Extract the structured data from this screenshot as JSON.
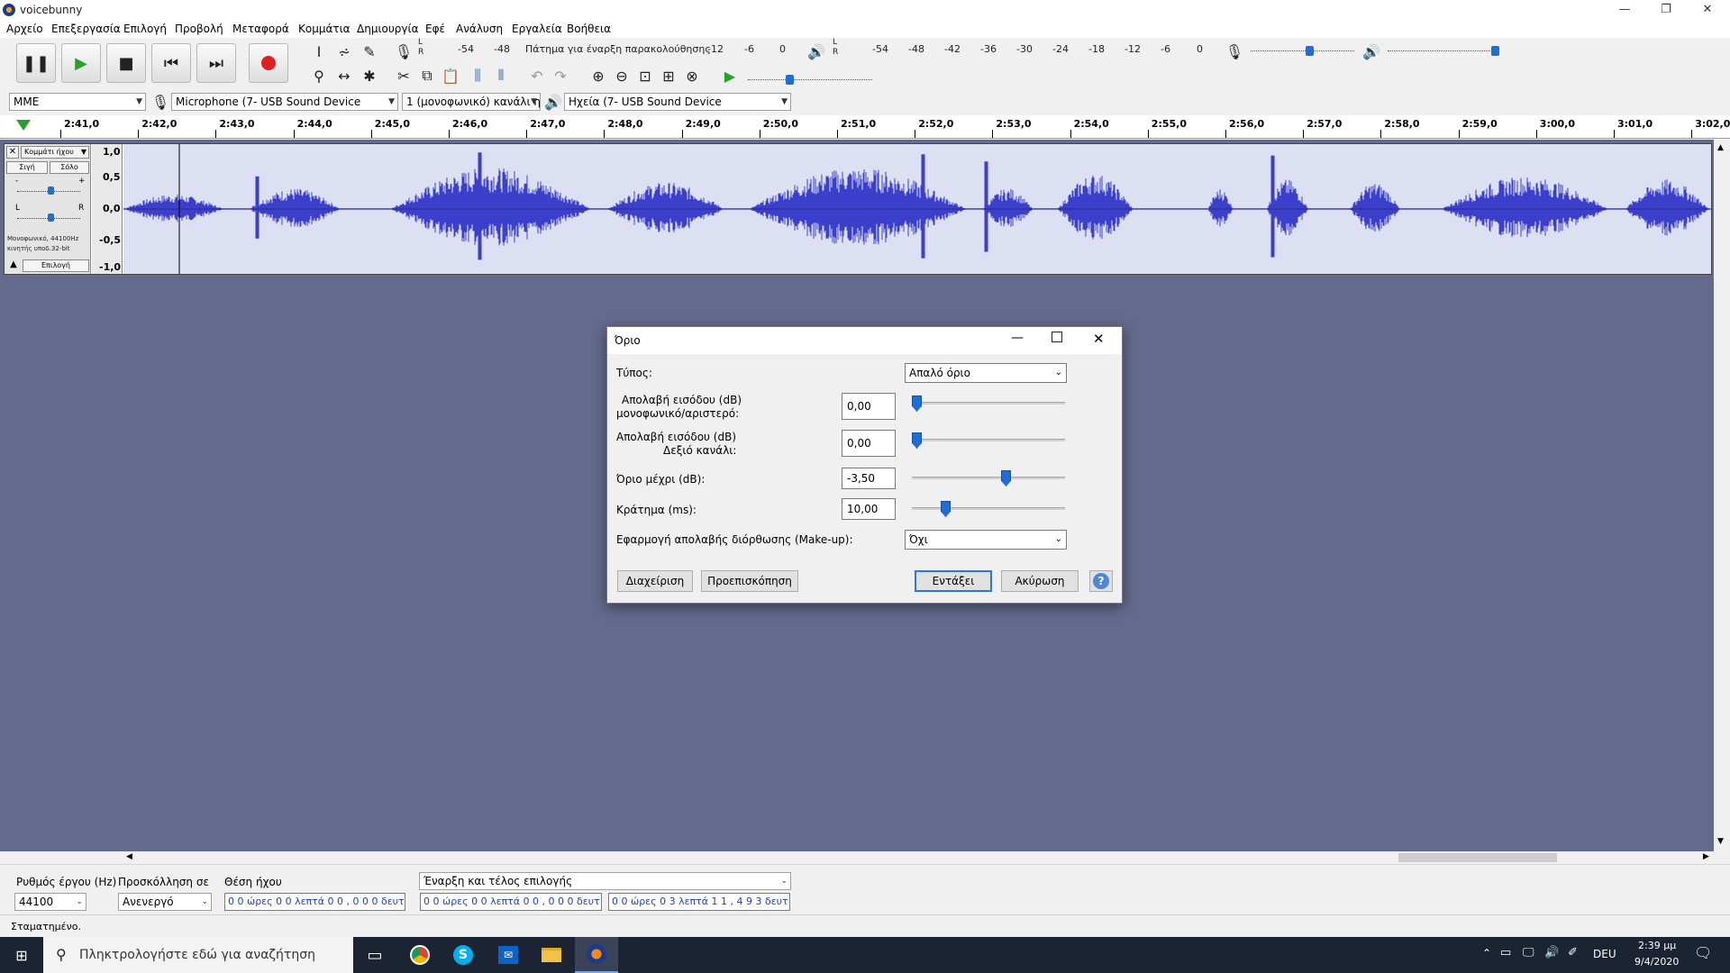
{
  "window": {
    "title": "voicebunny"
  },
  "menu": [
    "Αρχείο",
    "Επεξεργασία",
    "Επιλογή",
    "Προβολή",
    "Μεταφορά",
    "Κομμάτια",
    "Δημιουργία",
    "Εφέ",
    "Ανάλυση",
    "Εργαλεία",
    "Βοήθεια"
  ],
  "meters": {
    "rec_scale": [
      "-54",
      "-48",
      "Πάτημα για έναρξη παρακολούθησης",
      "-12",
      "-6",
      "0"
    ],
    "play_scale": [
      "-54",
      "-48",
      "-42",
      "-36",
      "-30",
      "-24",
      "-18",
      "-12",
      "-6",
      "0"
    ],
    "lr_l": "L",
    "lr_r": "R"
  },
  "devices": {
    "host": "MME",
    "recording": "Microphone (7- USB Sound Device",
    "channels": "1 (μονοφωνικό) κανάλι η",
    "playback": "Ηχεία (7- USB Sound Device"
  },
  "ruler": [
    "2:41,0",
    "2:42,0",
    "2:43,0",
    "2:44,0",
    "2:45,0",
    "2:46,0",
    "2:47,0",
    "2:48,0",
    "2:49,0",
    "2:50,0",
    "2:51,0",
    "2:52,0",
    "2:53,0",
    "2:54,0",
    "2:55,0",
    "2:56,0",
    "2:57,0",
    "2:58,0",
    "2:59,0",
    "3:00,0",
    "3:01,0",
    "3:02,0"
  ],
  "track": {
    "name": "Κομμάτι ήχου",
    "mute": "Σιγή",
    "solo": "Σόλο",
    "minus": "-",
    "plus": "+",
    "left": "L",
    "right": "R",
    "info": "Μονοφωνικό, 44100Hz κινητής υποδ.32-bit",
    "select": "Επιλογή",
    "scale": [
      "1,0",
      "0,5",
      "0,0",
      "-0,5",
      "-1,0"
    ]
  },
  "dialog": {
    "title": "Όριο",
    "type_label": "Τύπος:",
    "type_value": "Απαλό όριο",
    "gain_left_label1": "Απολαβή εισόδου (dB)",
    "gain_left_label2": "μονοφωνικό/αριστερό:",
    "gain_left_value": "0,00",
    "gain_right_label1": "Απολαβή εισόδου (dB)",
    "gain_right_label2": "Δεξιό κανάλι:",
    "gain_right_value": "0,00",
    "limit_label": "Όριο μέχρι (dB):",
    "limit_value": "-3,50",
    "hold_label": "Κράτημα (ms):",
    "hold_value": "10,00",
    "makeup_label": "Εφαρμογή απολαβής διόρθωσης (Make-up):",
    "makeup_value": "Όχι",
    "manage": "Διαχείριση",
    "preview": "Προεπισκόπηση",
    "ok": "Εντάξει",
    "cancel": "Ακύρωση",
    "help": "?"
  },
  "selection": {
    "rate_label": "Ρυθμός έργου (Hz)",
    "rate_value": "44100",
    "snap_label": "Προσκόλληση σε",
    "snap_value": "Ανενεργό",
    "pos_label": "Θέση ήχου",
    "pos_value": "0 0 ώρες 0 0 λεπτά 0 0 , 0 0 0 δευτ",
    "sel_mode": "Έναρξη και τέλος επιλογής",
    "start_value": "0 0 ώρες 0 0 λεπτά 0 0 , 0 0 0 δευτ",
    "end_value": "0 0 ώρες 0 3 λεπτά 1 1 , 4 9 3 δευτ"
  },
  "status": "Σταματημένο.",
  "taskbar": {
    "search_placeholder": "Πληκτρολογήστε εδώ για αναζήτηση",
    "lang": "DEU",
    "time": "2:39 μμ",
    "date": "9/4/2020"
  },
  "colors": {
    "wave": "#3b3fc9",
    "track_bg": "#636a8c",
    "accent": "#1e6ed6"
  }
}
